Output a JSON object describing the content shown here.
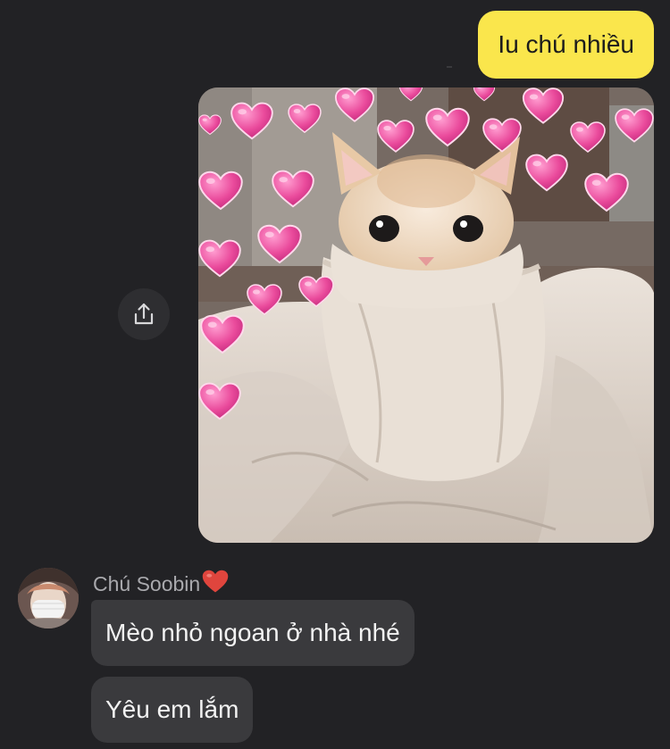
{
  "outgoing": {
    "message": "Iu chú nhiều",
    "bubble_color": "#fae64c"
  },
  "shared_image": {
    "subject": "cat wrapped in blanket with pink hearts"
  },
  "share_button": {
    "icon": "share-icon"
  },
  "incoming": {
    "sender_name": "Chú Soobin",
    "sender_emoji": "heart-icon",
    "messages": [
      "Mèo nhỏ ngoan ở nhà nhé",
      "Yêu em lắm"
    ],
    "bubble_color": "#3a3a3d"
  },
  "theme": {
    "background": "#222225",
    "heart_color": "#e8499a"
  }
}
